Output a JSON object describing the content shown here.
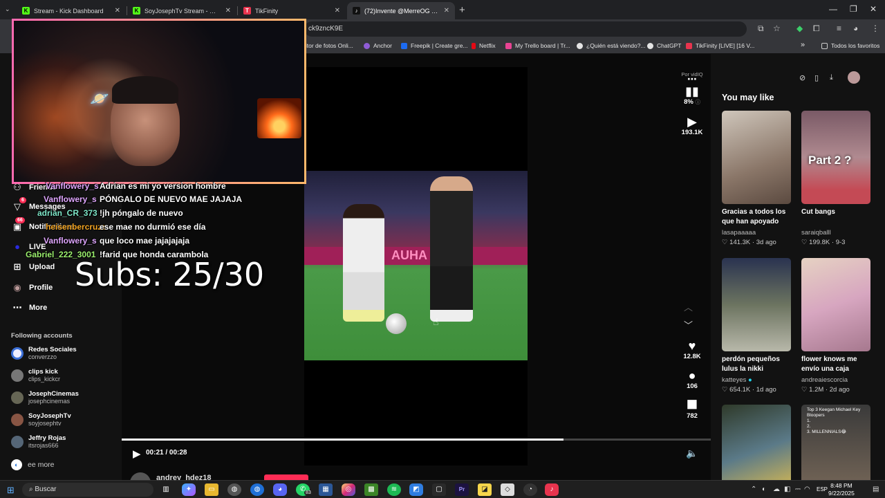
{
  "browser": {
    "tabs": [
      {
        "label": "Stream - Kick Dashboard",
        "icon": "kick-icon",
        "color": "#53fc18",
        "glyph": "K"
      },
      {
        "label": "SoyJosephTv Stream - Watch Li",
        "icon": "kick-icon",
        "color": "#53fc18",
        "glyph": "K"
      },
      {
        "label": "TikFinity",
        "icon": "tikfinity-icon",
        "color": "#e8344e",
        "glyph": "T"
      },
      {
        "label": "(72)Invente @MerreOG , inv",
        "icon": "tiktok-icon",
        "color": "#ffffff",
        "glyph": "♪"
      }
    ],
    "new_tab": "+",
    "url": "ck9zncK9E",
    "bookmarks": [
      {
        "label": "litor de fotos Onli...",
        "color": "#3a8dde"
      },
      {
        "label": "Anchor",
        "color": "#8f5cd6"
      },
      {
        "label": "Freepik | Create gre...",
        "color": "#1c6bf2"
      },
      {
        "label": "Netflix",
        "color": "#e50914"
      },
      {
        "label": "My Trello board | Tr...",
        "color": "#e84393"
      },
      {
        "label": "¿Quién está viendo?...",
        "color": "#e4e4e4"
      },
      {
        "label": "ChatGPT",
        "color": "#e4e4e4"
      },
      {
        "label": "TikFinity [LIVE] [16 V...",
        "color": "#e8344e"
      }
    ],
    "bookmarks_more": "»",
    "all_favorites": "Todos los favoritos"
  },
  "sidenav": {
    "items": [
      {
        "label": "Friends",
        "icon": "friends-icon",
        "glyph": "👥"
      },
      {
        "label": "Messages",
        "icon": "send-icon",
        "glyph": "▽",
        "badge": "6"
      },
      {
        "label": "Notifications",
        "icon": "inbox-icon",
        "glyph": "▣",
        "badge": "66"
      },
      {
        "label": "LIVE",
        "icon": "live-icon",
        "glyph": "●"
      },
      {
        "label": "Upload",
        "icon": "plus-square-icon",
        "glyph": "⊞"
      },
      {
        "label": "Profile",
        "icon": "avatar-icon",
        "glyph": "◉"
      },
      {
        "label": "More",
        "icon": "more-dots-icon",
        "glyph": "⋯"
      }
    ],
    "following_title": "Following accounts",
    "accounts": [
      {
        "name": "Redes Sociales",
        "handle": "converzzo",
        "color": "#3b6fd6"
      },
      {
        "name": "clips kick",
        "handle": "clips_kickcr",
        "color": "#777"
      },
      {
        "name": "JosephCinemas",
        "handle": "josephcinemas",
        "color": "#665"
      },
      {
        "name": "SoyJosephTv",
        "handle": "soyjosephtv",
        "color": "#854"
      },
      {
        "name": "Jeffry Rojas",
        "handle": "itsrojas666",
        "color": "#567"
      }
    ],
    "see_more": "ee more"
  },
  "video": {
    "time": "00:21 / 00:28",
    "progress": 0.75,
    "author": "andrey_hdez18",
    "watermark": "Por vidIQ",
    "score": "8%",
    "views": "193.1K",
    "likes": "12.8K",
    "comments": "106",
    "saves": "782",
    "ad_board": "AUHA"
  },
  "chat": [
    {
      "user": "Vanflowery_s",
      "msg": "Adrian es mi yo version hombre",
      "color": "#e0a7ff"
    },
    {
      "user": "Vanflowery_s",
      "msg": "PÓNGALO DE NUEVO MAE JAJAJA",
      "color": "#e0a7ff"
    },
    {
      "user": "adrian_CR_373",
      "msg": "!jh póngalo de nuevo",
      "color": "#7fe7c9"
    },
    {
      "user": "heisenbercruzz",
      "msg": "ese mae no durmió ese día",
      "color": "#f5a623"
    },
    {
      "user": "Vanflowery_s",
      "msg": "que loco mae jajajajaja",
      "color": "#e0a7ff"
    },
    {
      "user": "Gabriel_222_3001",
      "msg": "!farid que honda carambola",
      "color": "#9cf06e"
    }
  ],
  "subs": "Subs: 25/30",
  "you_may_like": {
    "title": "You may like",
    "cards": [
      {
        "caption": "Gracias a todos los que han apoyado el...",
        "author": "lasapaaaaa",
        "likes": "141.3K",
        "date": "3d ago",
        "bg": "linear-gradient(160deg,#cfc6bb,#8a7668 60%,#5b4a40)"
      },
      {
        "caption": "Cut bangs",
        "author": "saraiqballl",
        "likes": "199.8K",
        "date": "9-3",
        "bg": "linear-gradient(180deg,#7a5a66,#b08a90 50%,#c44a55 85%)",
        "overlay": "Part 2 ?"
      },
      {
        "caption": "perdón pequeños lulus la nikki apena...",
        "author": "katteyes",
        "likes": "654.1K",
        "date": "1d ago",
        "verified": true,
        "bg": "linear-gradient(180deg,#2a3350,#6c7460 50%,#b8b8aa)"
      },
      {
        "caption": "flower knows me envío una caja llena...",
        "author": "andreaiescorcia",
        "likes": "1.2M",
        "date": "2d ago",
        "bg": "linear-gradient(160deg,#e6d2c2,#d7a6c0 50%,#a6788e)"
      },
      {
        "caption": "",
        "author": "",
        "likes": "",
        "date": "",
        "bg": "linear-gradient(160deg,#2f3a2a,#5b7a88 50%,#e9c24a)"
      },
      {
        "caption": "",
        "author": "",
        "likes": "",
        "date": "",
        "bg": "linear-gradient(180deg,#3a3a3a,#7a6a5a)",
        "top_text": "Top 3 Keegan Michael Key Bloopers\n1.\n2.\n3. MILLENNIALS😂"
      }
    ]
  },
  "taskbar": {
    "search": "Buscar",
    "whatsapp_badge": "83",
    "lang": "ESP",
    "time": "8:48 PM",
    "date": "9/22/2025"
  }
}
